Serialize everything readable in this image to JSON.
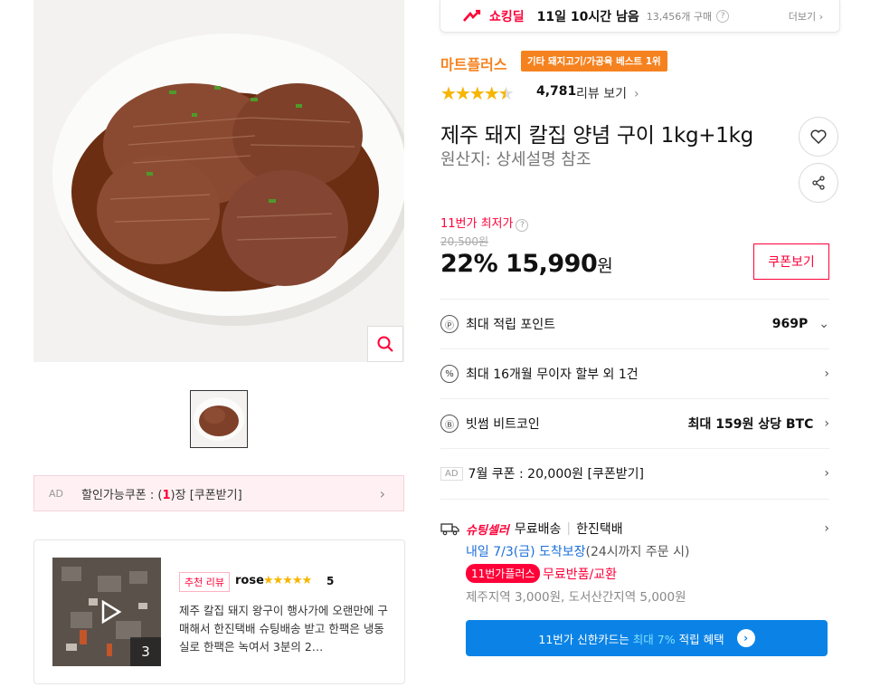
{
  "deal": {
    "label": "쇼킹딜",
    "time_left": "11일 10시간 남음",
    "sold": "13,456개 구매",
    "help": "?",
    "more": "더보기 ›"
  },
  "seller": {
    "brand": "마트플러스",
    "badge": "기타 돼지고기/가공육 베스트 1위"
  },
  "rating": {
    "stars": "★★★★★",
    "value": 4.5,
    "count": "4,781",
    "link": "리뷰 보기",
    "chevron": "›"
  },
  "product": {
    "title": "제주 돼지 칼집 양념 구이 1kg+1kg",
    "origin": "원산지: 상세설명 참조"
  },
  "price": {
    "lowest_label": "11번가 최저가",
    "help": "?",
    "original": "20,500원",
    "discount": "22%",
    "current": "15,990",
    "unit": "원",
    "coupon_button": "쿠폰보기"
  },
  "benefits": [
    {
      "icon": "Ⓟ",
      "icon_name": "point-icon",
      "label": "최대 적립 포인트",
      "value": "969P",
      "chevron": "⌄"
    },
    {
      "icon": "%",
      "icon_name": "percent-icon",
      "label": "최대 16개월 무이자 할부 외 1건",
      "value": "",
      "chevron": "›"
    },
    {
      "icon": "Ⓑ",
      "icon_name": "bitcoin-icon",
      "label": "빗썸 비트코인",
      "value": "최대 159원 상당 BTC",
      "chevron": "›"
    },
    {
      "icon": "AD",
      "icon_name": "ad-icon",
      "label": "7월 쿠폰 : 20,000원 [쿠폰받기]",
      "value": "",
      "chevron": "›"
    }
  ],
  "shipping": {
    "seller_label": "슈팅셀러",
    "free": "무료배송",
    "separator": "|",
    "carrier": "한진택배",
    "date": "내일 7/3(금) 도착보장",
    "date_note": "(24시까지 주문 시)",
    "plus_badge": "11번가플러스",
    "returns": "무료반품/교환",
    "fee": "제주지역 3,000원, 도서산간지역 5,000원",
    "card_promo": "11번가 신한카드는",
    "card_highlight": "최대 7%",
    "card_suffix": "적립 혜택",
    "chevron": "›"
  },
  "ad_coupon": {
    "tag": "AD",
    "prefix": "할인가능쿠폰 : (",
    "count": "1",
    "suffix": ")장 [쿠폰받기]",
    "chevron": "›"
  },
  "review": {
    "tag": "추천 리뷰",
    "user": "rose",
    "stars": "★★★★★",
    "score": "5",
    "photo_count": "3",
    "text": "제주 칼집 돼지 왕구이 행사가에 오랜만에 구매해서 한진택배 슈팅배송 받고 한팩은 냉동실로 한팩은 녹여서 3분의 2…"
  },
  "colors": {
    "accent": "#ff0038",
    "brand": "#f5821f",
    "star": "#f7b500",
    "link": "#1b6fd9",
    "button": "#0b83e6"
  }
}
